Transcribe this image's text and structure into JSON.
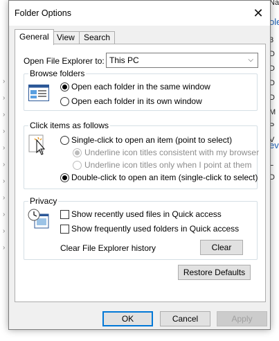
{
  "background": {
    "right_texts": [
      "Nam",
      "ole",
      "3",
      "D",
      "D",
      "D",
      "D",
      "M",
      "P",
      "V",
      "ev",
      "L",
      "D"
    ],
    "left_chevrons": 13
  },
  "dialog": {
    "title": "Folder Options",
    "close_glyph": "✕",
    "tabs": [
      {
        "label": "General",
        "active": true
      },
      {
        "label": "View",
        "active": false
      },
      {
        "label": "Search",
        "active": false
      }
    ],
    "open_explorer": {
      "label": "Open File Explorer to:",
      "value": "This PC"
    },
    "browse_folders": {
      "legend": "Browse folders",
      "options": [
        {
          "label": "Open each folder in the same window",
          "checked": true
        },
        {
          "label": "Open each folder in its own window",
          "checked": false
        }
      ]
    },
    "click_items": {
      "legend": "Click items as follows",
      "single_click": "Single-click to open an item (point to select)",
      "underline_browser": "Underline icon titles consistent with my browser",
      "underline_point": "Underline icon titles only when I point at them",
      "double_click": "Double-click to open an item (single-click to select)"
    },
    "privacy": {
      "legend": "Privacy",
      "show_recent_files": "Show recently used files in Quick access",
      "show_frequent_folders": "Show frequently used folders in Quick access",
      "clear_history_label": "Clear File Explorer history",
      "clear_button": "Clear"
    },
    "restore_defaults": "Restore Defaults",
    "buttons": {
      "ok": "OK",
      "cancel": "Cancel",
      "apply": "Apply"
    }
  }
}
